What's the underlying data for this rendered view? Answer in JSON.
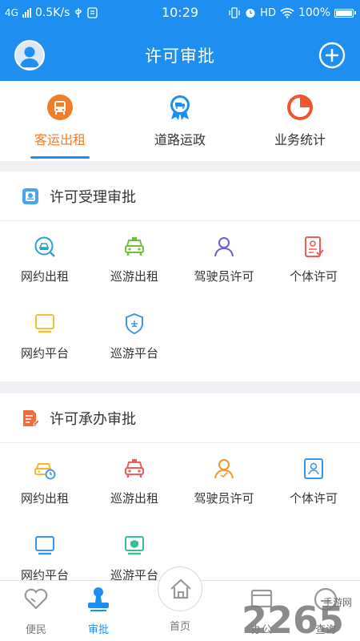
{
  "status_bar": {
    "network": "4G",
    "speed": "0.5K/s",
    "time": "10:29",
    "hd": "HD",
    "battery": "100%"
  },
  "header": {
    "title": "许可审批"
  },
  "tabs": [
    {
      "label": "客运出租",
      "icon": "taxi-icon"
    },
    {
      "label": "道路运政",
      "icon": "truck-badge-icon"
    },
    {
      "label": "业务统计",
      "icon": "pie-chart-icon"
    }
  ],
  "sections": [
    {
      "title": "许可受理审批",
      "icon": "approval-card-icon",
      "items": [
        {
          "label": "网约出租",
          "icon": "car-search-icon"
        },
        {
          "label": "巡游出租",
          "icon": "taxi-icon"
        },
        {
          "label": "驾驶员许可",
          "icon": "person-icon"
        },
        {
          "label": "个体许可",
          "icon": "id-doc-icon"
        },
        {
          "label": "网约平台",
          "icon": "screen-icon"
        },
        {
          "label": "巡游平台",
          "icon": "shield-icon"
        }
      ]
    },
    {
      "title": "许可承办审批",
      "icon": "document-edit-icon",
      "items": [
        {
          "label": "网约出租",
          "icon": "car-clock-icon"
        },
        {
          "label": "巡游出租",
          "icon": "taxi-icon"
        },
        {
          "label": "驾驶员许可",
          "icon": "person-icon"
        },
        {
          "label": "个体许可",
          "icon": "id-card-icon"
        },
        {
          "label": "网约平台",
          "icon": "monitor-icon"
        },
        {
          "label": "巡游平台",
          "icon": "screen-check-icon"
        }
      ]
    }
  ],
  "bottom_nav": [
    {
      "label": "便民",
      "icon": "heart-icon"
    },
    {
      "label": "审批",
      "icon": "stamp-icon"
    },
    {
      "label": "首页",
      "icon": "home-icon"
    },
    {
      "label": "办公",
      "icon": "office-icon"
    },
    {
      "label": "查询",
      "icon": "query-icon"
    }
  ],
  "watermark": {
    "text": "2265",
    "site": "手游网"
  },
  "colors": {
    "header_blue": "#1e8ff0",
    "accent_orange": "#f07d2a",
    "active_blue": "#1e8ff0"
  }
}
